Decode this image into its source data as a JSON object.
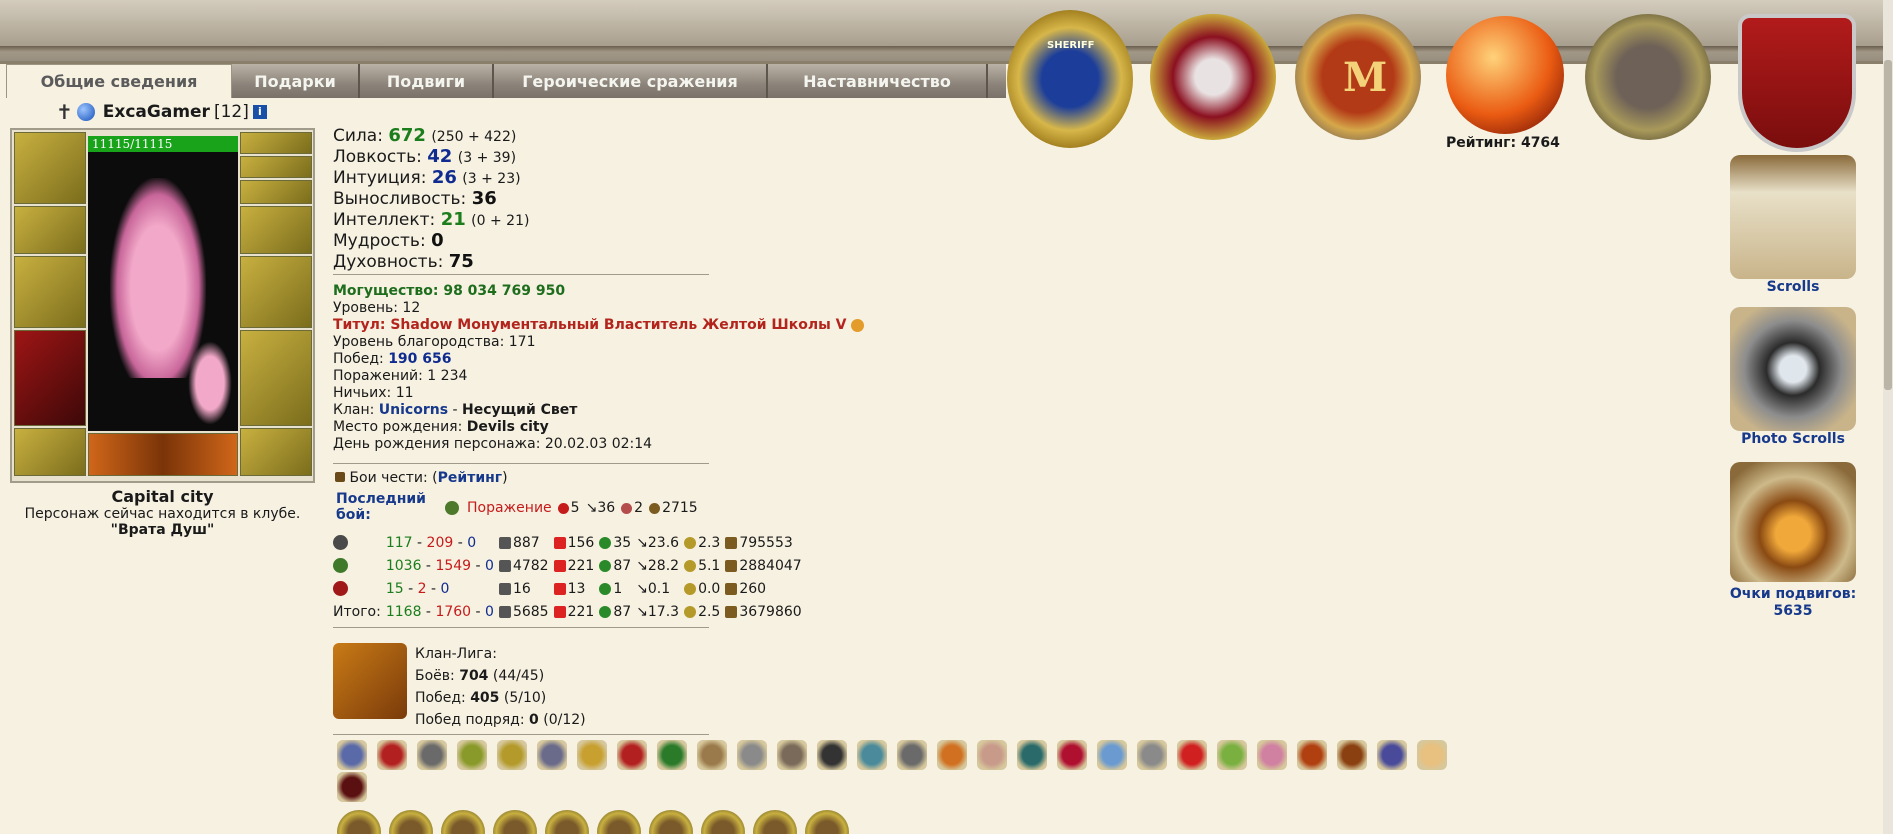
{
  "tabs": [
    {
      "label": "Общие сведения",
      "active": true
    },
    {
      "label": "Подарки",
      "active": false
    },
    {
      "label": "Подвиги",
      "active": false
    },
    {
      "label": "Героические сражения",
      "active": false
    },
    {
      "label": "Наставничество",
      "active": false
    }
  ],
  "medals": {
    "rating_label": "Рейтинг: 4764",
    "sheriff_text": "SHERIFF",
    "m_letter": "M"
  },
  "character": {
    "name": "ExcaGamer",
    "level_tag": "[12]",
    "hp": "11115/11115",
    "location_title": "Capital city",
    "location_line": "Персонаж сейчас находится в клубе.",
    "location_club": "\"Врата Душ\""
  },
  "stats": [
    {
      "label": "Сила: ",
      "value": "672",
      "extra": "(250 + 422)",
      "color": "green"
    },
    {
      "label": "Ловкость: ",
      "value": "42",
      "extra": "(3 + 39)",
      "color": "blue"
    },
    {
      "label": "Интуиция: ",
      "value": "26",
      "extra": "(3 + 23)",
      "color": "blue"
    },
    {
      "label": "Выносливость: ",
      "value": "36",
      "extra": "",
      "color": "black"
    },
    {
      "label": "Интеллект: ",
      "value": "21",
      "extra": "(0 + 21)",
      "color": "green"
    },
    {
      "label": "Мудрость: ",
      "value": "0",
      "extra": "",
      "color": "black"
    },
    {
      "label": "Духовность: ",
      "value": "75",
      "extra": "",
      "color": "black"
    }
  ],
  "info": {
    "power": "Могущество: 98 034 769 950",
    "level": "Уровень: 12",
    "title": "Титул: Shadow Монументальный Властитель Желтой Школы V",
    "nobility": "Уровень благородства: 171",
    "wins_label": "Побед: ",
    "wins_value": "190 656",
    "losses": "Поражений: 1 234",
    "draws": "Ничьих: 11",
    "clan_label": "Клан: ",
    "clan_name": "Unicorns",
    "clan_sep": " - ",
    "clan_rank": "Несущий Свет",
    "birthplace_label": "Место рождения: ",
    "birthplace_value": "Devils city",
    "birthday": "День рождения персонажа: 20.02.03 02:14"
  },
  "honor": {
    "label": "Бои чести: (",
    "link": "Рейтинг",
    "close": ")"
  },
  "last_fight": {
    "label_line1": "Последний",
    "label_line2": "бой:",
    "result": "Поражение",
    "a": "5",
    "b": "36",
    "c": "2",
    "d": "2715"
  },
  "fight_rows": [
    {
      "w": "117",
      "l": "209",
      "d": "0",
      "s1": "887",
      "s2": "156",
      "s3": "35",
      "s4": "23.6",
      "s5": "2.3",
      "s6": "795553"
    },
    {
      "w": "1036",
      "l": "1549",
      "d": "0",
      "s1": "4782",
      "s2": "221",
      "s3": "87",
      "s4": "28.2",
      "s5": "5.1",
      "s6": "2884047"
    },
    {
      "w": "15",
      "l": "2",
      "d": "0",
      "s1": "16",
      "s2": "13",
      "s3": "1",
      "s4": "0.1",
      "s5": "0.0",
      "s6": "260"
    }
  ],
  "fight_total": {
    "label": "Итого:",
    "w": "1168",
    "l": "1760",
    "d": "0",
    "s1": "5685",
    "s2": "221",
    "s3": "87",
    "s4": "17.3",
    "s5": "2.5",
    "s6": "3679860"
  },
  "league": {
    "title": "Клан-Лига:",
    "battles_label": "Боёв: ",
    "battles_value": "704",
    "battles_extra": "(44/45)",
    "wins_label": "Побед: ",
    "wins_value": "405",
    "wins_extra": "(5/10)",
    "streak_label": "Побед подряд: ",
    "streak_value": "0",
    "streak_extra": "(0/12)"
  },
  "right_column": {
    "scrolls": "Scrolls",
    "photo_scrolls": "Photo Scrolls",
    "feats_label": "Очки подвигов:",
    "feats_value": "5635"
  },
  "colors": {
    "green": "#1c7d1c",
    "blue": "#0f2b8f",
    "red": "#c61b1b",
    "link": "#17398c",
    "background": "#f6f1e1"
  }
}
